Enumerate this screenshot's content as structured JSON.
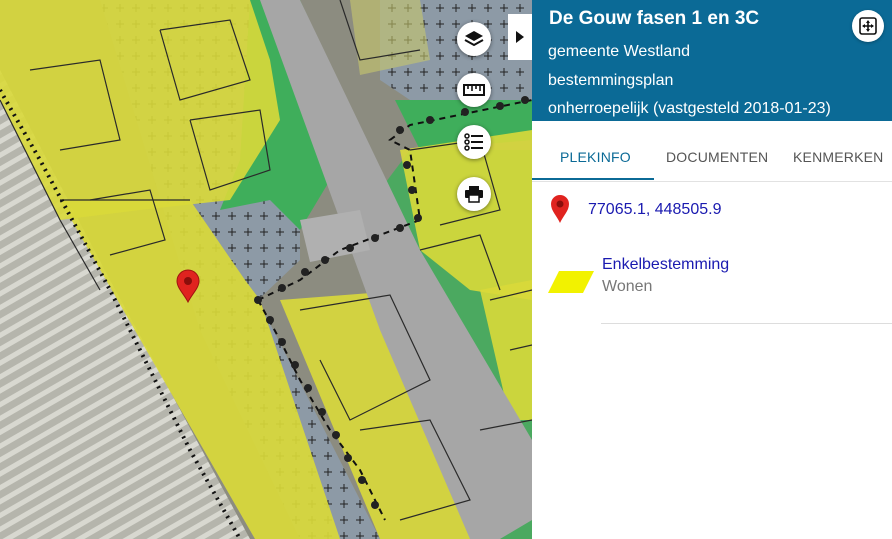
{
  "map": {
    "colors": {
      "aerial": "#9a9a8a",
      "wonen": "#d9d93a",
      "verkeer": "#8d9aa6",
      "groen": "#3fae5b",
      "weg": "#a6a6a6",
      "tuin": "#b8c096",
      "border": "#2a2a2a",
      "marker": "#e0231f"
    },
    "tools": [
      {
        "name": "layers-icon",
        "label": "lagen"
      },
      {
        "name": "ruler-icon",
        "label": "meten"
      },
      {
        "name": "legend-list-icon",
        "label": "legenda"
      },
      {
        "name": "print-icon",
        "label": "printen"
      }
    ]
  },
  "panel": {
    "title": "De Gouw fasen 1 en 3C",
    "municipality": "gemeente Westland",
    "plan_type": "bestemmingsplan",
    "status": "onherroepelijk (vastgesteld 2018-01-23)",
    "accent_color": "#0b6a96",
    "tabs": [
      "PLEKINFO",
      "DOCUMENTEN",
      "KENMERKEN"
    ],
    "active_tab": "PLEKINFO",
    "coordinates": "77065.1, 448505.9",
    "bestemming": {
      "type": "Enkelbestemming",
      "name": "Wonen",
      "swatch_color": "#f2f200"
    }
  }
}
